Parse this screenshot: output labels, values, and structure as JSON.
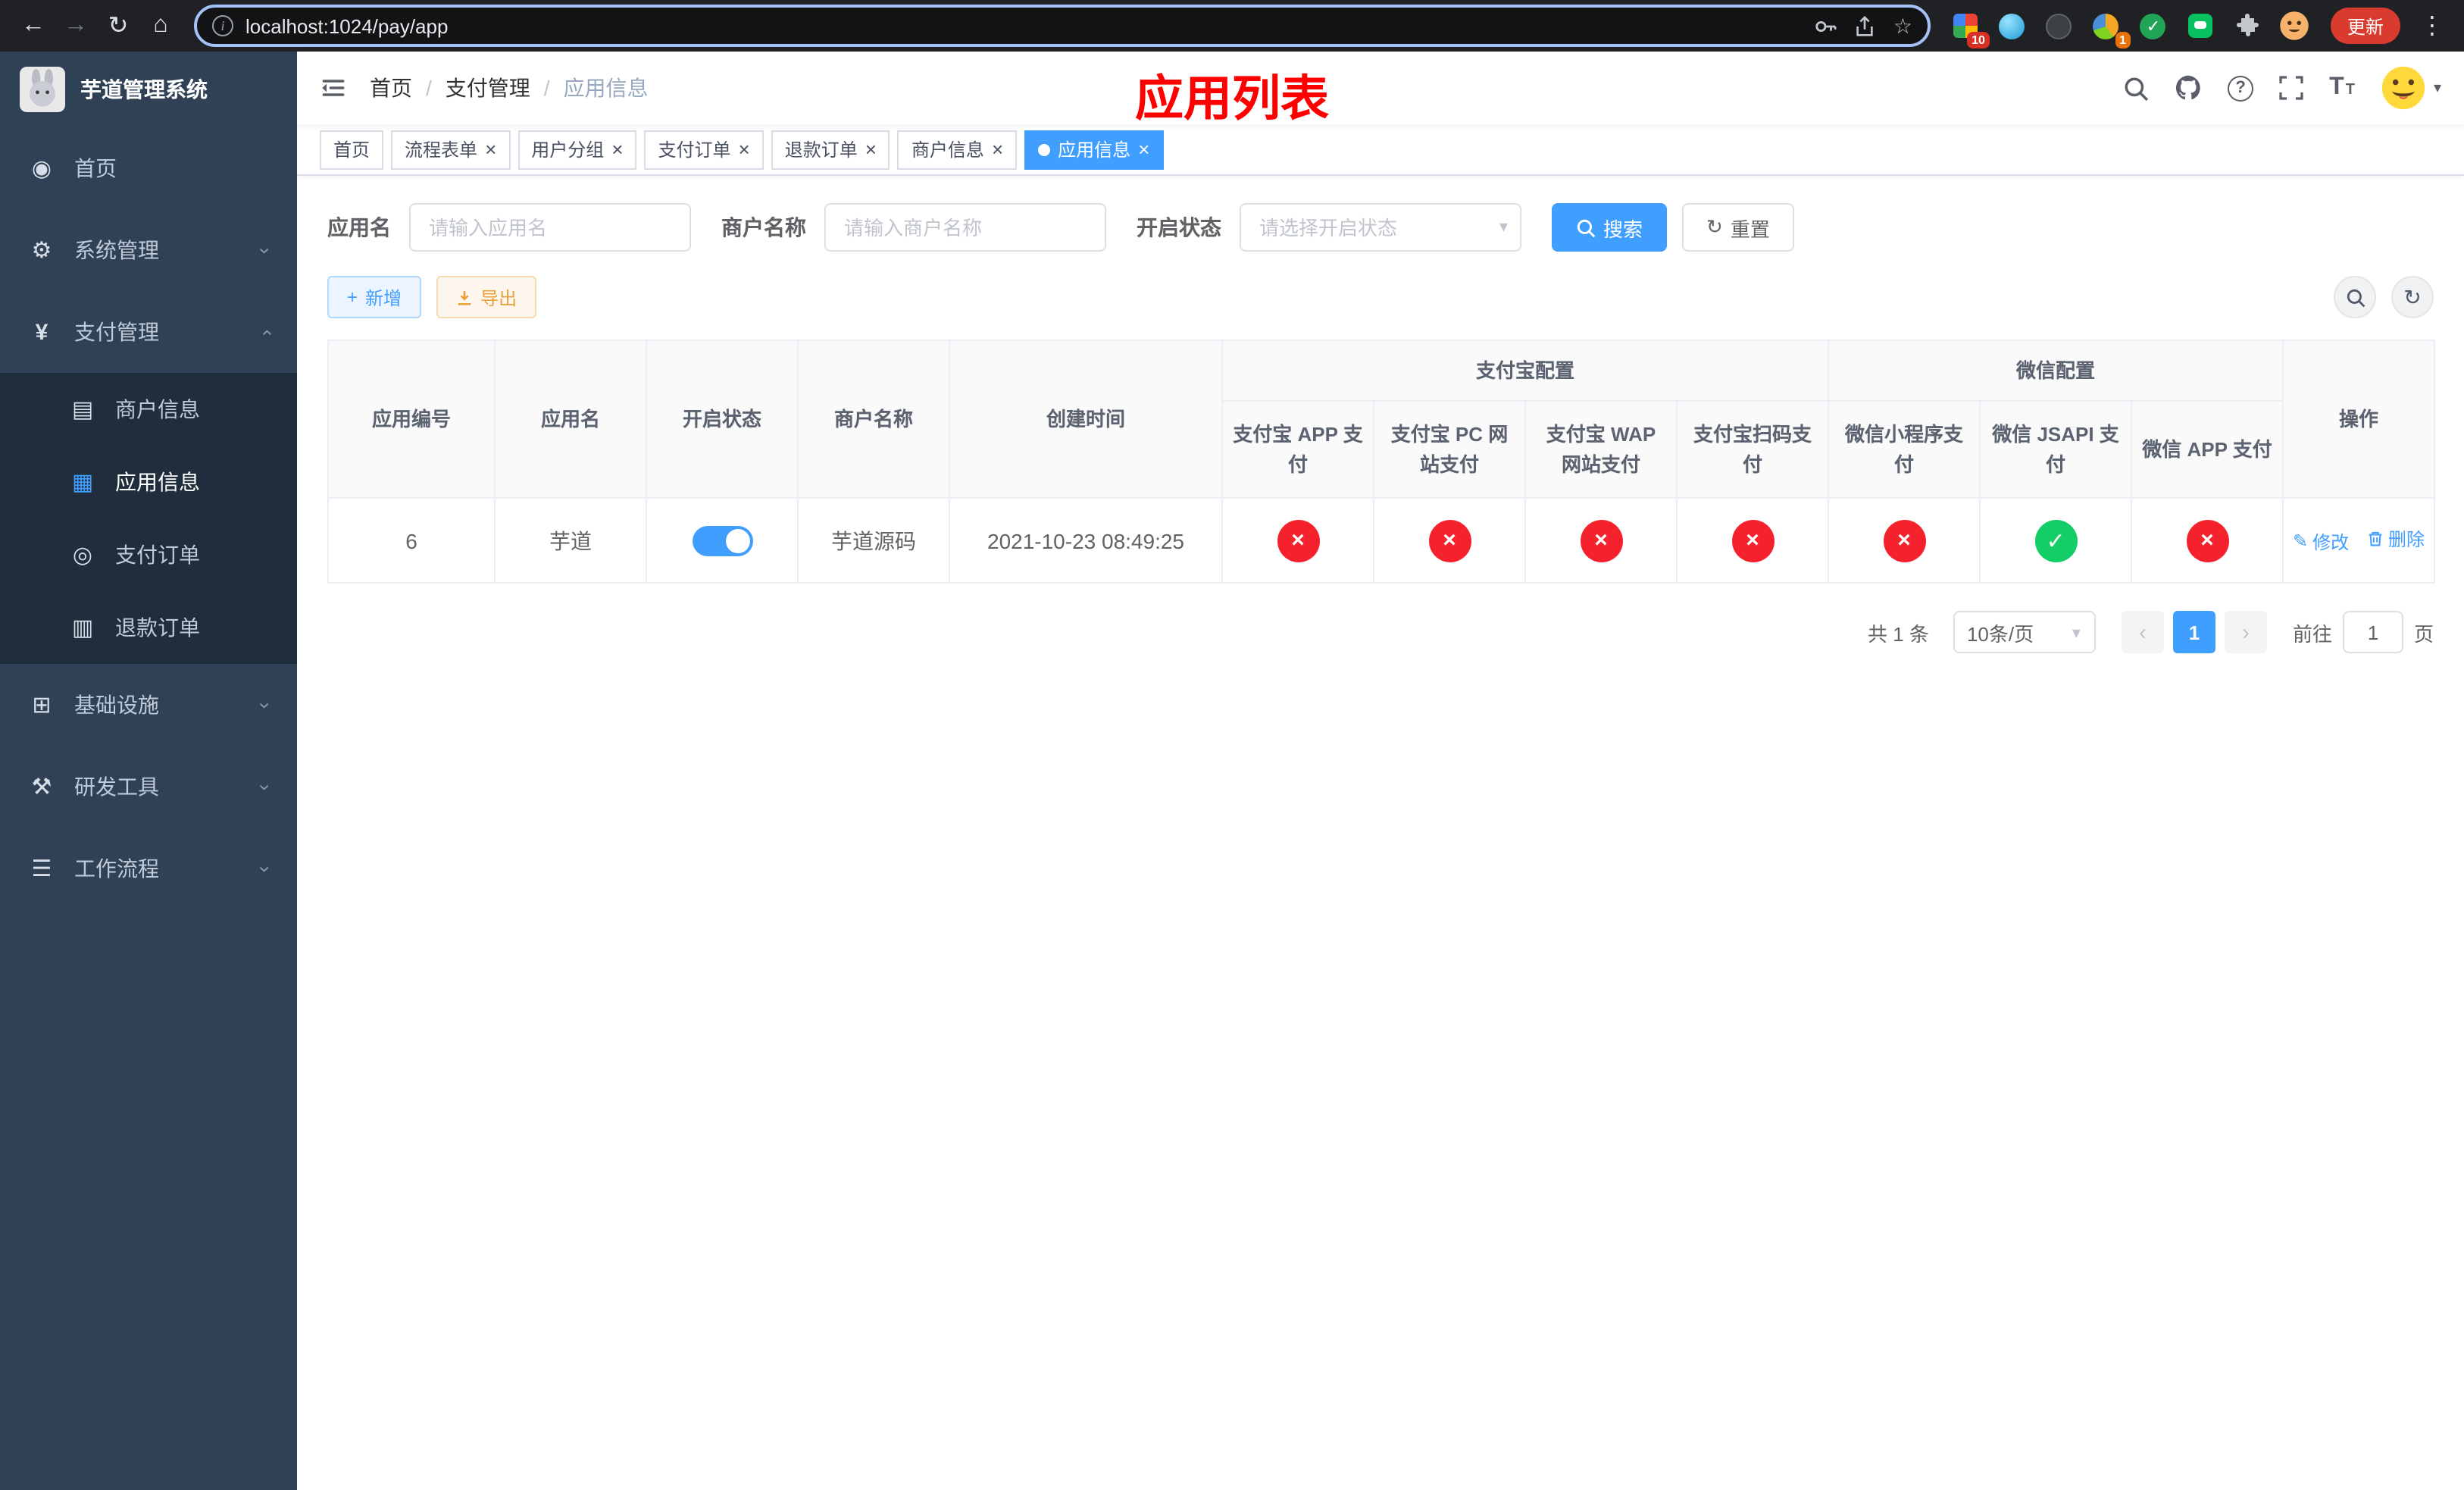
{
  "colors": {
    "accent": "#409eff",
    "danger": "#f5222d",
    "success": "#13ce66",
    "warning": "#e6a23c",
    "sidebar_bg": "#304156",
    "submenu_bg": "#1f2d3d",
    "annotation_red": "#ff0000"
  },
  "icons": {
    "back": "←",
    "forward": "→",
    "reload": "↻",
    "home": "⌂",
    "star": "☆",
    "kebab": "⋮",
    "info": "i",
    "question": "?",
    "dashboard": "◉",
    "gear": "⚙",
    "yen": "¥",
    "card": "▤",
    "grid": "▦",
    "coin": "◎",
    "doc": "▥",
    "infra": "⊞",
    "tool": "⚒",
    "flow": "☰",
    "chevron": "›",
    "separator": "/",
    "plus": "+",
    "refresh": "↻",
    "caret": "▾",
    "close": "×",
    "cross": "×",
    "check": "✓",
    "prev": "‹",
    "next": "›",
    "pencil": "✎",
    "font_big": "T",
    "font_small": "T"
  },
  "browser": {
    "url": "localhost:1024/pay/app",
    "update_label": "更新",
    "ext_badge_grid": "10",
    "ext_badge_avatar": "1"
  },
  "sidebar": {
    "title": "芋道管理系统",
    "menu": [
      {
        "label": "首页"
      },
      {
        "label": "系统管理"
      },
      {
        "label": "支付管理"
      },
      {
        "label": "基础设施"
      },
      {
        "label": "研发工具"
      },
      {
        "label": "工作流程"
      }
    ],
    "submenu": [
      {
        "label": "商户信息"
      },
      {
        "label": "应用信息"
      },
      {
        "label": "支付订单"
      },
      {
        "label": "退款订单"
      }
    ]
  },
  "header": {
    "breadcrumb": [
      "首页",
      "支付管理",
      "应用信息"
    ],
    "annotation": "应用列表"
  },
  "tabs": [
    {
      "label": "首页"
    },
    {
      "label": "流程表单"
    },
    {
      "label": "用户分组"
    },
    {
      "label": "支付订单"
    },
    {
      "label": "退款订单"
    },
    {
      "label": "商户信息"
    },
    {
      "label": "应用信息"
    }
  ],
  "filters": {
    "app_name_label": "应用名",
    "app_name_placeholder": "请输入应用名",
    "merchant_label": "商户名称",
    "merchant_placeholder": "请输入商户名称",
    "status_label": "开启状态",
    "status_placeholder": "请选择开启状态",
    "search_label": "搜索",
    "reset_label": "重置"
  },
  "toolbar": {
    "add_label": "新增",
    "export_label": "导出"
  },
  "table": {
    "group_alipay": "支付宝配置",
    "group_wechat": "微信配置",
    "col_id": "应用编号",
    "col_name": "应用名",
    "col_status": "开启状态",
    "col_merchant": "商户名称",
    "col_created": "创建时间",
    "col_alipay_app": "支付宝 APP 支付",
    "col_alipay_pc": "支付宝 PC 网站支付",
    "col_alipay_wap": "支付宝 WAP 网站支付",
    "col_alipay_qr": "支付宝扫码支付",
    "col_wx_lite": "微信小程序支付",
    "col_wx_jsapi": "微信 JSAPI 支付",
    "col_wx_app": "微信 APP 支付",
    "col_actions": "操作",
    "row": {
      "id": "6",
      "name": "芋道",
      "status_on": true,
      "merchant": "芋道源码",
      "created": "2021-10-23 08:49:25",
      "channels": [
        "no",
        "no",
        "no",
        "no",
        "no",
        "yes",
        "no"
      ],
      "edit_label": "修改",
      "delete_label": "删除"
    }
  },
  "pagination": {
    "total_text": "共 1 条",
    "page_size": "10条/页",
    "current_page": "1",
    "goto_label": "前往",
    "goto_value": "1",
    "unit_label": "页"
  }
}
